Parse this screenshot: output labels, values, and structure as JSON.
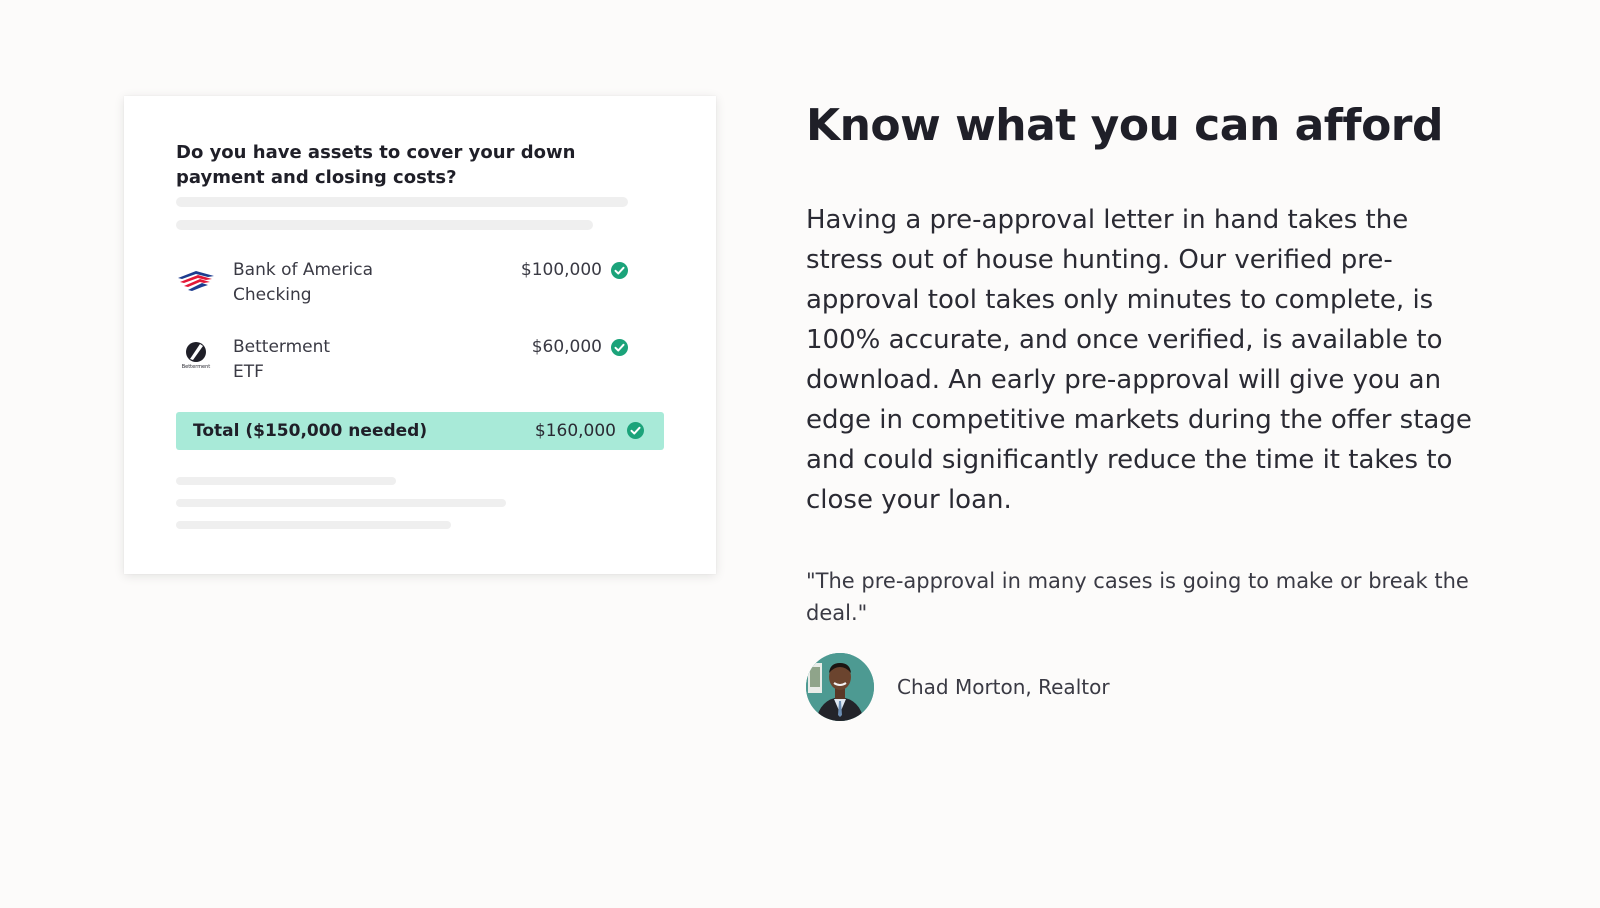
{
  "card": {
    "question": "Do you have assets to cover your down payment and closing costs?",
    "assets": [
      {
        "name_line1": "Bank of America",
        "name_line2": "Checking",
        "amount": "$100,000",
        "logo": "bank-of-america-logo"
      },
      {
        "name_line1": "Betterment",
        "name_line2": "ETF",
        "amount": "$60,000",
        "logo": "betterment-logo",
        "logo_text": "Betterment"
      }
    ],
    "total": {
      "label": "Total ($150,000 needed)",
      "amount": "$160,000"
    }
  },
  "content": {
    "heading": "Know what you can afford",
    "body": "Having a pre-approval letter in hand takes the stress out of house hunting. Our verified pre-approval tool takes only minutes to complete, is 100% accurate, and once verified, is available to download. An early pre-approval will give you an edge in competitive markets during the offer stage and could significantly reduce the time it takes to close your loan.",
    "quote": "\"The pre-approval in many cases is going to make or break the deal.\"",
    "author": "Chad Morton, Realtor"
  },
  "colors": {
    "check": "#1ba37a",
    "total_bar": "#a8ead8",
    "background": "#fcfbfa"
  }
}
